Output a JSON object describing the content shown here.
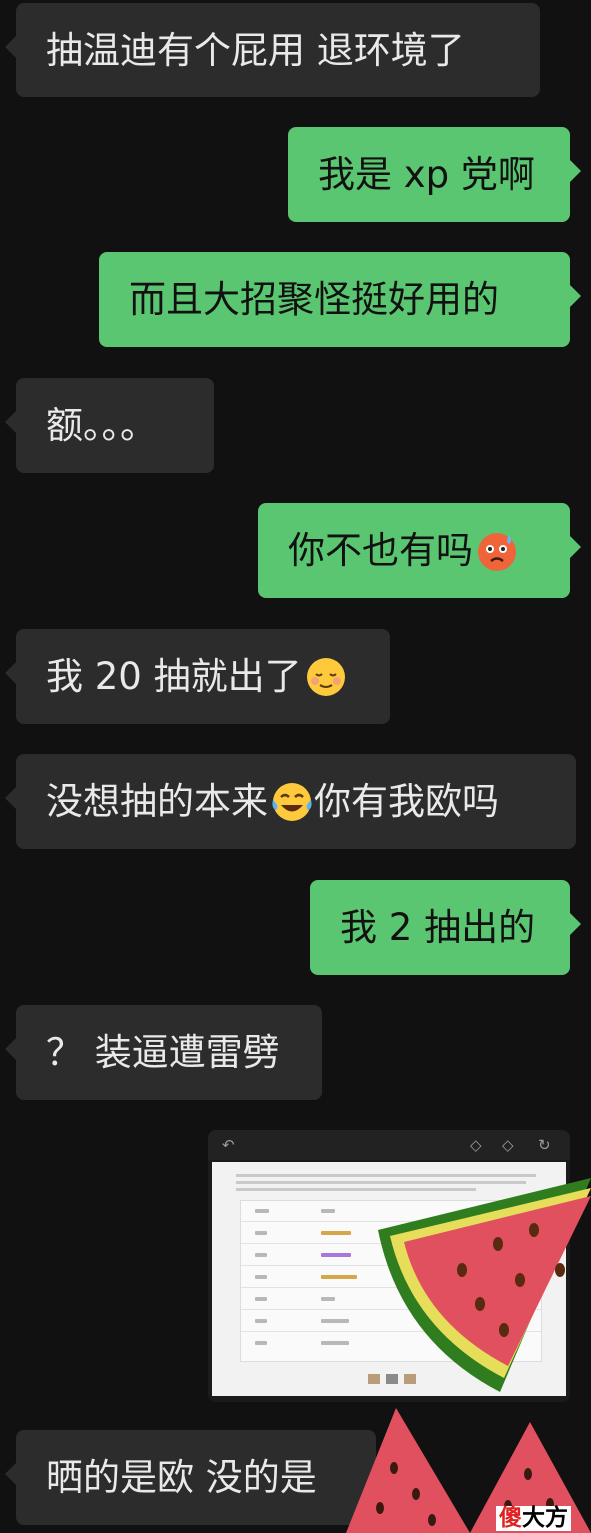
{
  "messages": [
    {
      "side": "in",
      "text": "抽温迪有个屁用 退环境了"
    },
    {
      "side": "out",
      "text": "我是 xp 党啊"
    },
    {
      "side": "out",
      "text": "而且大招聚怪挺好用的"
    },
    {
      "side": "in",
      "text": "额。。。"
    },
    {
      "side": "out",
      "text": "你不也有吗",
      "emoji": "anxious-sweat-emoji"
    },
    {
      "side": "in",
      "text": "我 20 抽就出了",
      "emoji": "relieved-smile-emoji"
    },
    {
      "side": "in",
      "text": "没想抽的本来",
      "emoji": "tears-of-joy-emoji",
      "text_after": "你有我欧吗"
    },
    {
      "side": "out",
      "text": "我 2 抽出的"
    },
    {
      "side": "in",
      "text": "？ 装逼遭雷劈"
    },
    {
      "side": "in",
      "text": "晒的是欧 没的是"
    }
  ],
  "image_message": {
    "kind": "screenshot",
    "icons": [
      "back-arrow-icon",
      "diamond-icon",
      "diamond-icon",
      "refresh-icon"
    ]
  },
  "stickers": [
    "watermelon-sticker",
    "watermelon-sticker",
    "watermelon-sticker"
  ],
  "watermark": {
    "part1": "傻",
    "part2": "大方"
  },
  "colors": {
    "background": "#111111",
    "incoming": "#2c2c2c",
    "outgoing": "#5ac671",
    "melon_flesh": "#e0505f",
    "melon_rind": "#8ec63f"
  }
}
